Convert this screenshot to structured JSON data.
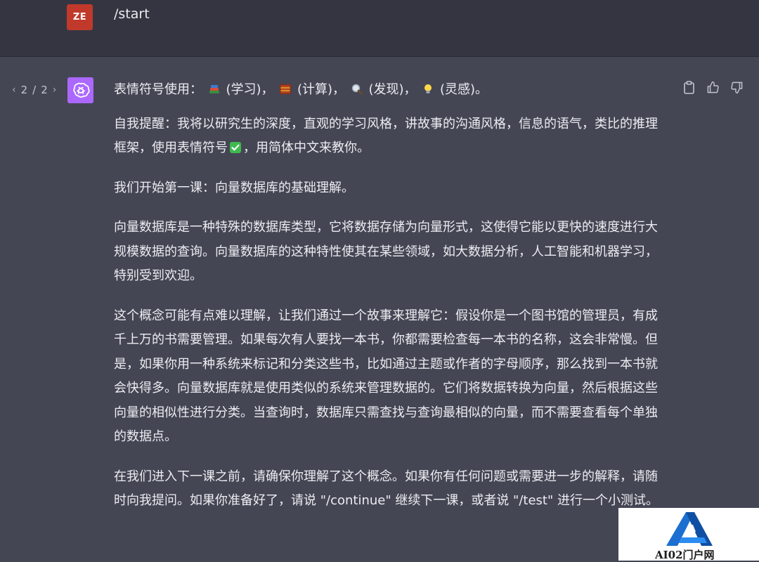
{
  "user_message": {
    "avatar_initials": "ZE",
    "text": "/start"
  },
  "assistant_message": {
    "pager": {
      "current": "2",
      "separator": "/",
      "total": "2"
    },
    "emoji_line": {
      "prefix": "表情符号使用：",
      "items": [
        {
          "icon": "books-emoji",
          "label": "(学习)，"
        },
        {
          "icon": "abacus-emoji",
          "label": "(计算)，"
        },
        {
          "icon": "magnifier-emoji",
          "label": "(发现)，"
        },
        {
          "icon": "lightbulb-emoji",
          "label": "(灵感)。"
        }
      ]
    },
    "reminder_before": "自我提醒：我将以研究生的深度，直观的学习风格，讲故事的沟通风格，信息的语气，类比的推理框架，使用表情符号",
    "reminder_after": "，用简体中文来教你。",
    "paragraphs": [
      "我们开始第一课：向量数据库的基础理解。",
      "向量数据库是一种特殊的数据库类型，它将数据存储为向量形式，这使得它能以更快的速度进行大规模数据的查询。向量数据库的这种特性使其在某些领域，如大数据分析，人工智能和机器学习，特别受到欢迎。",
      "这个概念可能有点难以理解，让我们通过一个故事来理解它：假设你是一个图书馆的管理员，有成千上万的书需要管理。如果每次有人要找一本书，你都需要检查每一本书的名称，这会非常慢。但是，如果你用一种系统来标记和分类这些书，比如通过主题或作者的字母顺序，那么找到一本书就会快得多。向量数据库就是使用类似的系统来管理数据的。它们将数据转换为向量，然后根据这些向量的相似性进行分类。当查询时，数据库只需查找与查询最相似的向量，而不需要查看每个单独的数据点。",
      "在我们进入下一课之前，请确保你理解了这个概念。如果你有任何问题或需要进一步的解释，请随时向我提问。如果你准备好了，请说 \"/continue\" 继续下一课，或者说 \"/test\" 进行一个小测试。"
    ]
  },
  "watermark": {
    "text": "AI02门户网"
  },
  "colors": {
    "user_bg": "#343541",
    "assistant_bg": "#444654",
    "user_avatar": "#c0392b",
    "bot_avatar": "#ab68ff",
    "text": "#ececf1"
  }
}
